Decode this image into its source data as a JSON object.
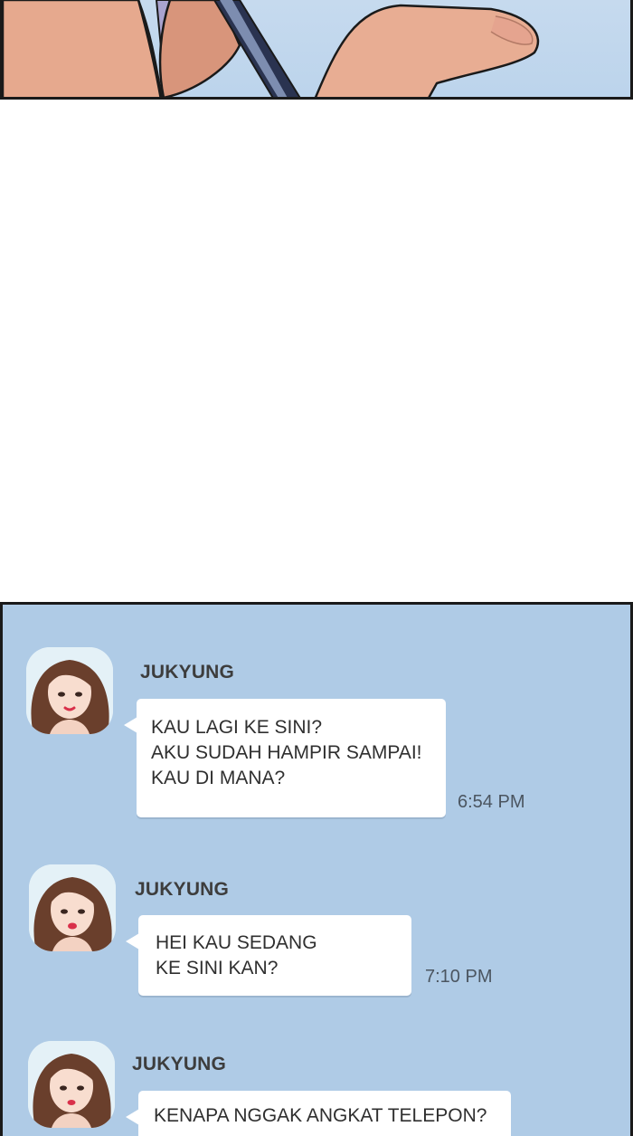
{
  "messages": [
    {
      "sender": "JUKYUNG",
      "lines": [
        "KAU LAGI KE SINI?",
        "AKU SUDAH HAMPIR SAMPAI!",
        "KAU DI MANA?"
      ],
      "time": "6:54 PM"
    },
    {
      "sender": "JUKYUNG",
      "lines": [
        "HEI KAU SEDANG",
        "KE SINI KAN?"
      ],
      "time": "7:10 PM"
    },
    {
      "sender": "JUKYUNG",
      "lines": [
        "KENAPA NGGAK ANGKAT TELEPON?"
      ],
      "time": ""
    }
  ],
  "colors": {
    "chat_background": "#afcbe6",
    "bubble": "#ffffff",
    "panel_border": "#1a1a1a"
  }
}
